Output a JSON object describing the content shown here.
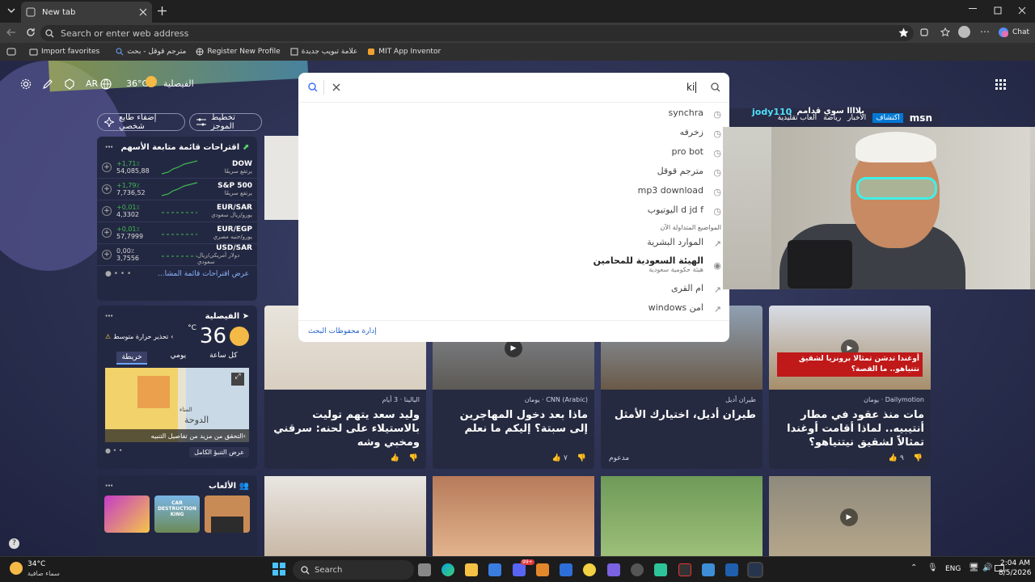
{
  "browser": {
    "tab_title": "New tab",
    "address_placeholder": "Search or enter web address",
    "chat_label": "Chat",
    "favorites": [
      {
        "label": "Import favorites",
        "icon": "folder-icon"
      },
      {
        "label": "مترجم قوقل - بحث",
        "icon": "search-icon"
      },
      {
        "label": "Register New Profile",
        "icon": "globe-icon"
      },
      {
        "label": "علامة تبويب جديدة",
        "icon": "page-icon"
      },
      {
        "label": "MIT App Inventor",
        "icon": "mit-icon"
      }
    ]
  },
  "header": {
    "language": "AR",
    "temperature": "36°C",
    "location": "الفيصلية",
    "personalize_label": "إضفاء طابع شخصي",
    "layout_label": "تخطيط الموجز"
  },
  "search": {
    "query": "ki",
    "suggestions": [
      {
        "text": "synchra",
        "type": "history"
      },
      {
        "text": "زخرفه",
        "type": "history"
      },
      {
        "text": "pro bot",
        "type": "history"
      },
      {
        "text": "مترجم قوقل",
        "type": "history"
      },
      {
        "text": "mp3 download",
        "type": "history"
      },
      {
        "text": "d jd f اليوتيوب",
        "type": "history"
      }
    ],
    "trending_header": "المواضيع المتداولة الآن",
    "trending": [
      {
        "text": "الموارد البشرية",
        "sub": ""
      },
      {
        "text": "الهيئة السعودية للمحامين",
        "sub": "هيئة حكومية سعودية"
      },
      {
        "text": "ام القرى",
        "sub": ""
      },
      {
        "text": "امن windows",
        "sub": ""
      }
    ],
    "manage_label": "إدارة محفوظات البحث"
  },
  "msn": {
    "brand": "msn",
    "tabs": [
      "اكتشاف",
      "الأخبار",
      "رياضة",
      "ألعاب تقليدية"
    ],
    "banner_user": "jody110",
    "banner_text": "يلاااا سوي قدامم"
  },
  "stocks": {
    "title": "اقتراحات قائمة متابعة الأسهم",
    "more_link": "عرض اقتراحات قائمة المشا...",
    "rows": [
      {
        "name": "DOW",
        "sub": "يرتفع سريعًا",
        "change": "+1,71٪",
        "value": "54,085,88",
        "trend": "up"
      },
      {
        "name": "S&P 500",
        "sub": "يرتفع سريعًا",
        "change": "+1,79٪",
        "value": "7,736,52",
        "trend": "up"
      },
      {
        "name": "EUR/SAR",
        "sub": "يورو/ريال سعودي",
        "change": "+0,01٪",
        "value": "4,3302",
        "trend": "flat"
      },
      {
        "name": "EUR/EGP",
        "sub": "يورو/جنيه مصري",
        "change": "+0,01٪",
        "value": "57,7999",
        "trend": "flat"
      },
      {
        "name": "USD/SAR",
        "sub": "دولار أمريكي/ريال سعودي",
        "change": "0,00٪",
        "value": "3,7556",
        "trend": "flat"
      }
    ]
  },
  "weather": {
    "location": "الفيصلية",
    "temp": "36",
    "unit": "°C",
    "alert": "تحذير حرارة متوسط",
    "tabs": [
      "كل ساعة",
      "يومي",
      "خريطة"
    ],
    "map_label": "الدوحة",
    "map_place": "المناء",
    "map_cta": "التحقق من مزيد من تفاصيل التنبيه",
    "full_forecast": "عرض التنبؤ الكامل"
  },
  "games": {
    "title": "الألعاب",
    "tile": "CAR DESTRUCTION KING"
  },
  "news": [
    {
      "source": "اليالينا",
      "time": "3 أيام",
      "title": "وليد سعد يتهم توليت بالاستيلاء على لحنه: سرقني ومخبي وشه",
      "likes": "",
      "video": false
    },
    {
      "source": "CNN (Arabic)",
      "time": "يومان",
      "title": "ماذا بعد دخول المهاجرين إلى سبتة؟ إليكم ما نعلم",
      "likes": "٧",
      "video": true
    },
    {
      "source": "طيران أديل",
      "time": "",
      "title": "طيران أديل، اختيارك الأمثل",
      "likes": "مدعوم",
      "video": false
    },
    {
      "source": "Dailymotion",
      "time": "يومان",
      "title": "مات منذ عقود في مطار أنتيبيه.. لماذا أقامت أوغندا تمثالاً لشقيق نيتنياهو؟",
      "likes": "٩",
      "video": true
    }
  ],
  "news_overlay": "أوغندا تدشن تمثالا برونزيا لشقيق نتنياهو.. ما القصة؟",
  "taskbar": {
    "weather_temp": "34°C",
    "weather_desc": "سماء صافية",
    "search_label": "Search",
    "language": "ENG",
    "time": "2:04 AM",
    "date": "8/5/2026",
    "badge": "99+"
  },
  "colors": {
    "accent": "#0078d4",
    "stock_up": "#3fb950",
    "page_bg": "#2d3253"
  }
}
